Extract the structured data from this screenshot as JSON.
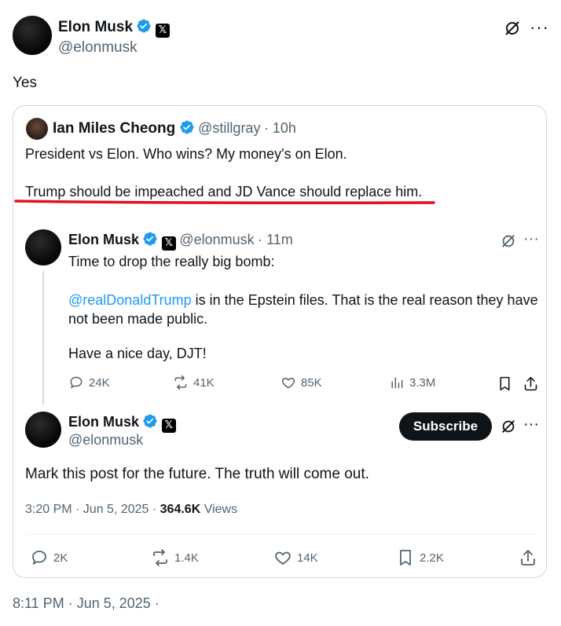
{
  "main_post": {
    "author_name": "Elon Musk",
    "author_handle": "@elonmusk",
    "text": "Yes",
    "timestamp": "8:11 PM · Jun 5, 2025 ·"
  },
  "quoted_post": {
    "author_name": "Ian Miles Cheong",
    "author_handle": "@stillgray",
    "time_ago": "· 10h",
    "line1": "President vs Elon. Who wins? My money's on Elon.",
    "line2": "Trump should be impeached and JD Vance should replace him.",
    "underline_color": "#e0101e"
  },
  "thread_post_1": {
    "author_name": "Elon Musk",
    "author_handle": "@elonmusk",
    "time_ago": "· 11m",
    "line1": "Time to drop the really big bomb:",
    "mention": "@realDonaldTrump",
    "line2_rest": " is in the Epstein files. That is the real reason they have",
    "line3": "not been made public.",
    "line4": "Have a nice day, DJT!",
    "metrics": {
      "replies": "24K",
      "reposts": "41K",
      "likes": "85K",
      "views": "3.3M"
    }
  },
  "thread_post_2": {
    "author_name": "Elon Musk",
    "author_handle": "@elonmusk",
    "subscribe_label": "Subscribe",
    "text": "Mark this post for the future. The truth will come out.",
    "time_date": "3:20 PM · Jun 5, 2025 · ",
    "views_count": "364.6K",
    "views_label": " Views",
    "metrics": {
      "replies": "2K",
      "reposts": "1.4K",
      "likes": "14K",
      "bookmarks": "2.2K"
    }
  },
  "colors": {
    "accent": "#1d9bf0",
    "muted": "#536471",
    "border": "#cfd9de"
  },
  "icons": [
    "verified-badge-icon",
    "x-logo-icon",
    "grok-icon",
    "more-icon",
    "reply-icon",
    "repost-icon",
    "like-icon",
    "views-icon",
    "bookmark-icon",
    "share-icon"
  ]
}
